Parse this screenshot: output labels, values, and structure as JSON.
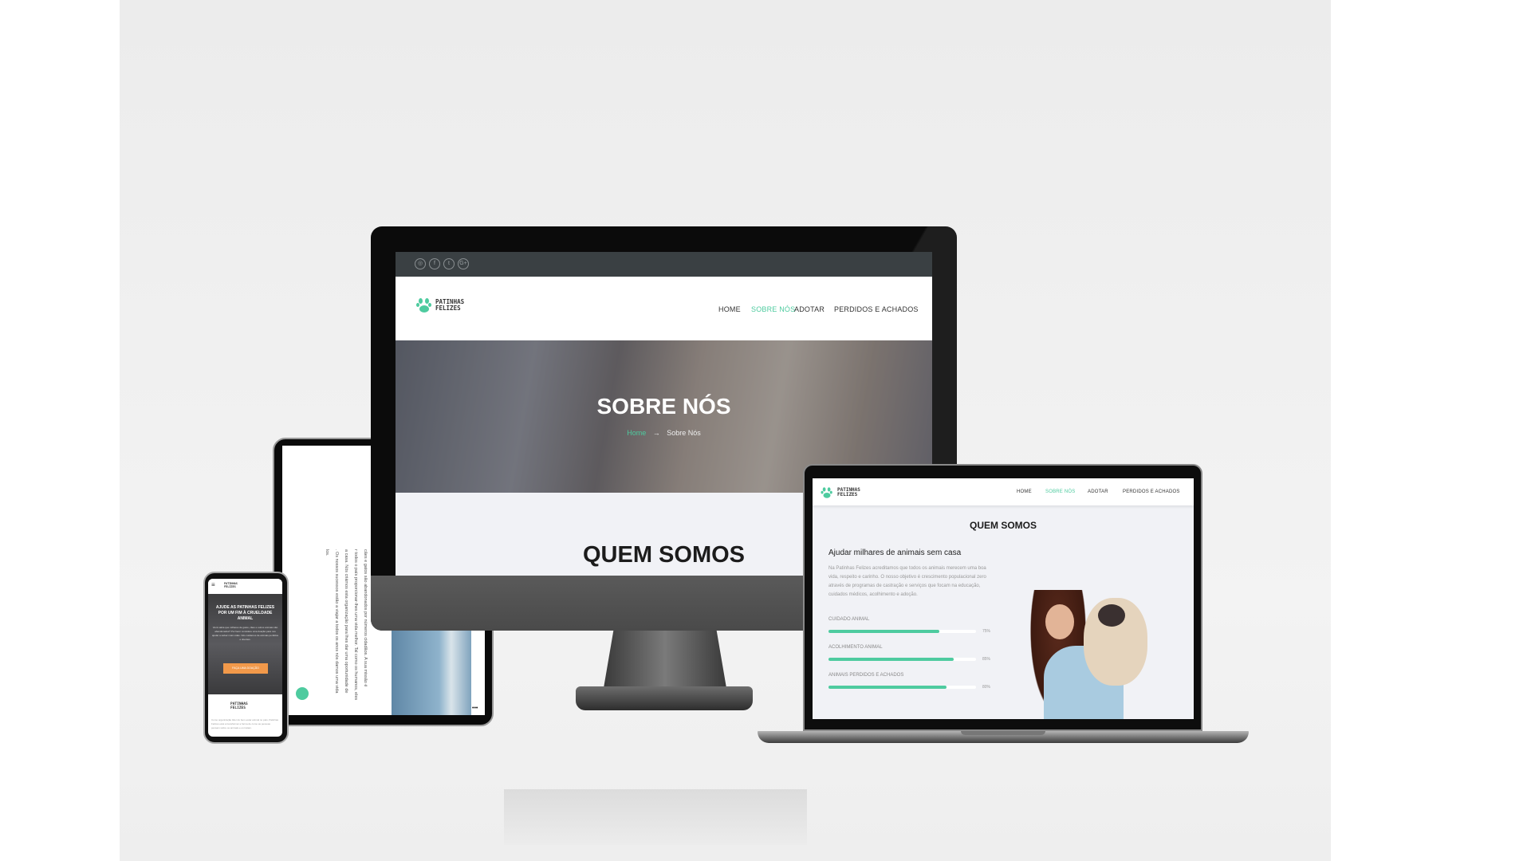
{
  "monitor": {
    "social_icons": [
      "instagram-icon",
      "facebook-icon",
      "twitter-icon",
      "google-plus-icon"
    ],
    "social_glyphs": [
      "◎",
      "f",
      "t",
      "G+"
    ],
    "logo": {
      "line1": "PATINHAS",
      "line2": "FELIZES"
    },
    "nav": [
      {
        "label": "HOME",
        "active": false
      },
      {
        "label": "SOBRE NÓS",
        "active": true
      },
      {
        "label": "ADOTAR",
        "active": false
      },
      {
        "label": "PERDIDOS E ACHADOS",
        "active": false
      }
    ],
    "hero_title": "SOBRE NÓS",
    "breadcrumb": {
      "home": "Home",
      "separator": "→",
      "current": "Sobre Nós"
    },
    "section_title": "QUEM SOMOS"
  },
  "laptop": {
    "logo": {
      "line1": "PATINHAS",
      "line2": "FELIZES"
    },
    "nav": [
      {
        "label": "HOME",
        "active": false
      },
      {
        "label": "SOBRE NÓS",
        "active": true
      },
      {
        "label": "ADOTAR",
        "active": false
      },
      {
        "label": "PERDIDOS E ACHADOS",
        "active": false
      }
    ],
    "section_title": "QUEM SOMOS",
    "subtitle": "Ajudar milhares de animais sem casa",
    "paragraph": "Na Patinhas Felizes acreditamos que todos os animais merecem uma boa vida, respeito e carinho. O nosso objetivo é crescimento populacional zero através de programas de castração e serviços que focam na educação, cuidados médicos, acolhimento e adoção.",
    "skills": [
      {
        "label": "CUIDADO ANIMAL",
        "percent": 75,
        "percent_label": "75%"
      },
      {
        "label": "ACOLHIMENTO ANIMAL",
        "percent": 85,
        "percent_label": "85%"
      },
      {
        "label": "ANIMAIS PERDIDOS E ACHADOS",
        "percent": 80,
        "percent_label": "80%"
      }
    ]
  },
  "tablet": {
    "lines": [
      "cães e gatos são abandonados por números cidadãos. A sua missão é",
      "r todos o país proporcionar-lhes uma vida melhor. Tal como os humanos, eles",
      "a casa. Nós criámos esta organização para lhes dar uma oportunidade de",
      ". Os nossos sucessos estão a viajar a todos os anos nós damos uma vida",
      "los."
    ],
    "more_label": "•••"
  },
  "phone": {
    "logo": {
      "line1": "PATINHAS",
      "line2": "FELIZES"
    },
    "hero_title": "AJUDE AS PATINHAS FELIZES POR UM FIM À CRUELDADE ANIMAL",
    "hero_text": "Você sabia que milhares de gatos, cães e outros animais são abandonados? Por favor considere uma doação para nos ajudar a salvar mais vidas. Nós cuidamos de animais perdidos e doentes.",
    "donate_button": "FAÇA UMA DOAÇÃO",
    "footer_text": "Como organização líder do bem-estar animal no país, Patinhas Felizes está a transformar a forma de como as pessoas pensam sobre os animais e os tratam."
  },
  "colors": {
    "accent": "#4ecb9f",
    "topbar": "#3a4043",
    "donate": "#f2994a"
  }
}
